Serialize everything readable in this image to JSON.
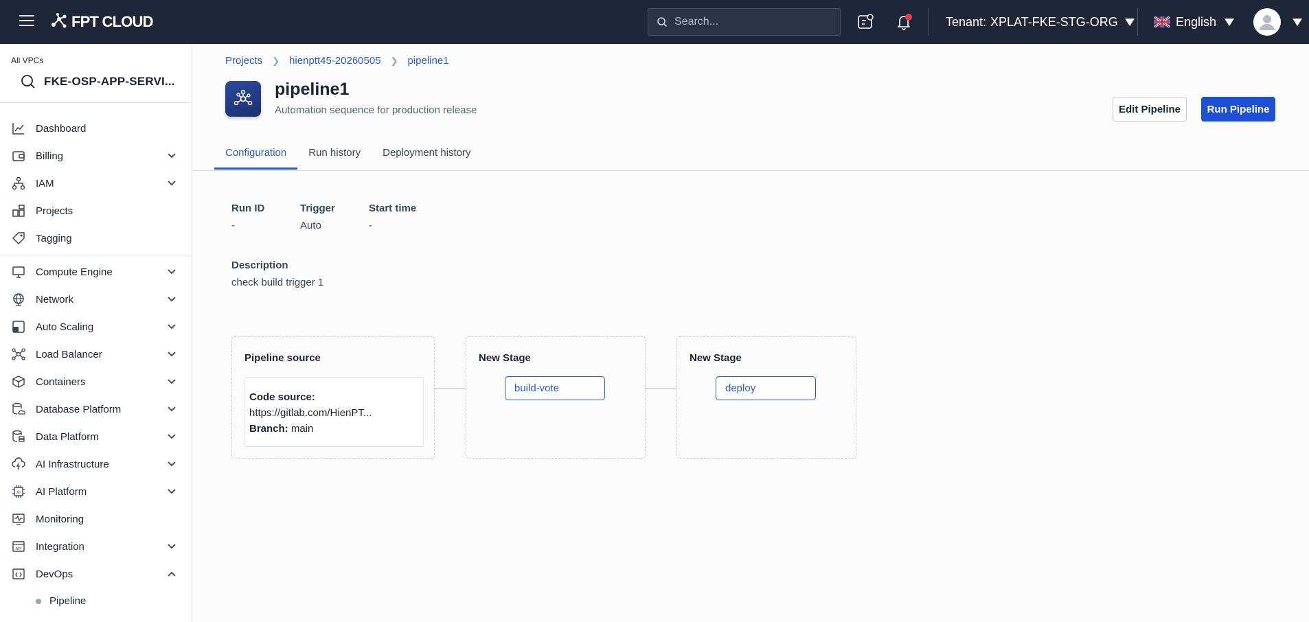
{
  "header": {
    "brand": "FPT CLOUD",
    "search_placeholder": "Search...",
    "tenant_label": "Tenant:",
    "tenant_value": "XPLAT-FKE-STG-ORG",
    "language": "English"
  },
  "sidebar": {
    "vpc_label": "All VPCs",
    "vpc_name": "FKE-OSP-APP-SERVI...",
    "items": [
      {
        "label": "Dashboard",
        "icon": "dashboard-chart-icon",
        "expandable": false
      },
      {
        "label": "Billing",
        "icon": "wallet-icon",
        "expandable": true
      },
      {
        "label": "IAM",
        "icon": "org-tree-icon",
        "expandable": true
      },
      {
        "label": "Projects",
        "icon": "blocks-icon",
        "expandable": false
      },
      {
        "label": "Tagging",
        "icon": "tag-icon",
        "expandable": false
      },
      {
        "label": "Compute Engine",
        "icon": "monitor-icon",
        "expandable": true
      },
      {
        "label": "Network",
        "icon": "globe-icon",
        "expandable": true
      },
      {
        "label": "Auto Scaling",
        "icon": "scaling-icon",
        "expandable": true
      },
      {
        "label": "Load Balancer",
        "icon": "nodes-icon",
        "expandable": true
      },
      {
        "label": "Containers",
        "icon": "cube-icon",
        "expandable": true
      },
      {
        "label": "Database Platform",
        "icon": "database-cloud-icon",
        "expandable": true
      },
      {
        "label": "Data Platform",
        "icon": "database-stack-icon",
        "expandable": true
      },
      {
        "label": "AI Infrastructure",
        "icon": "cloud-bolt-icon",
        "expandable": true
      },
      {
        "label": "AI Platform",
        "icon": "ai-chip-icon",
        "expandable": true
      },
      {
        "label": "Monitoring",
        "icon": "pulse-monitor-icon",
        "expandable": false
      },
      {
        "label": "Integration",
        "icon": "api-icon",
        "expandable": true
      },
      {
        "label": "DevOps",
        "icon": "code-window-icon",
        "expandable": true,
        "expanded": true
      }
    ],
    "subitems": [
      {
        "label": "Pipeline"
      }
    ]
  },
  "breadcrumb": [
    "Projects",
    "hienptt45-20260505",
    "pipeline1"
  ],
  "page": {
    "title": "pipeline1",
    "subtitle": "Automation sequence for production release",
    "edit_button": "Edit Pipeline",
    "run_button": "Run Pipeline"
  },
  "tabs": [
    {
      "label": "Configuration",
      "active": true
    },
    {
      "label": "Run history",
      "active": false
    },
    {
      "label": "Deployment history",
      "active": false
    }
  ],
  "details": {
    "run_id_label": "Run ID",
    "run_id_value": "-",
    "trigger_label": "Trigger",
    "trigger_value": "Auto",
    "start_time_label": "Start time",
    "start_time_value": "-",
    "description_label": "Description",
    "description_value": "check build trigger 1"
  },
  "pipeline": {
    "source": {
      "title": "Pipeline source",
      "code_source_label": "Code source:",
      "code_source_value": "https://gitlab.com/HienPT...",
      "branch_label": "Branch:",
      "branch_value": "main"
    },
    "stages": [
      {
        "title": "New Stage",
        "job": "build-vote"
      },
      {
        "title": "New Stage",
        "job": "deploy"
      }
    ]
  },
  "colors": {
    "topbar": "#1e2737",
    "accent": "#2a5bc6",
    "primary_button": "#1e50d6",
    "notification": "#ef3b45"
  }
}
